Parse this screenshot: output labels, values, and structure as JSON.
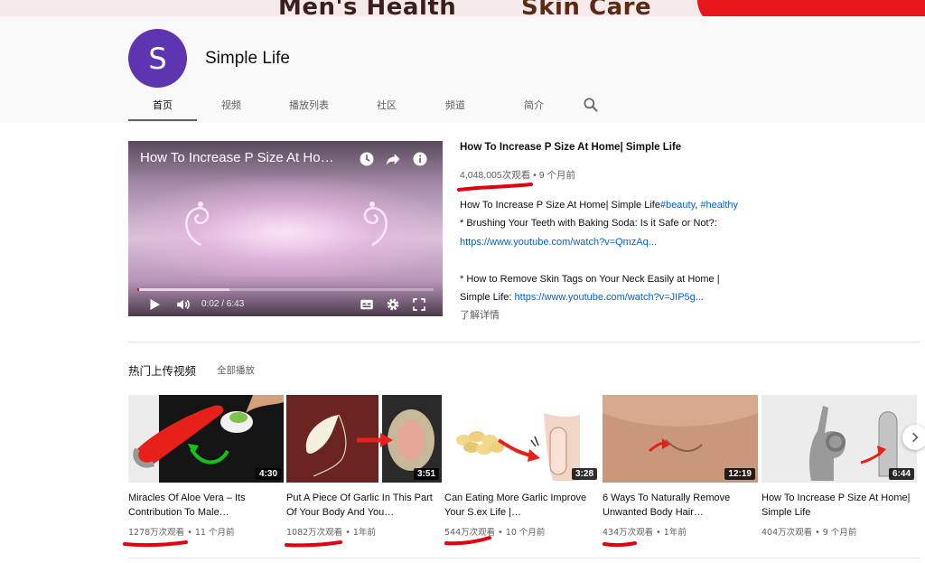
{
  "banner": {
    "text_left": "Men's Health",
    "text_right": "Skin Care"
  },
  "channel": {
    "avatar_letter": "S",
    "name": "Simple Life",
    "avatar_color": "#5e35b1"
  },
  "tabs": [
    {
      "label": "首页",
      "active": true
    },
    {
      "label": "视频"
    },
    {
      "label": "播放列表"
    },
    {
      "label": "社区"
    },
    {
      "label": "频道"
    },
    {
      "label": "简介"
    }
  ],
  "featured": {
    "overlay_title": "How To Increase P Size At Home| Simple Life",
    "time": "0:02 / 6:43",
    "progress": 0.005,
    "title": "How To Increase P Size At Home| Simple Life",
    "views": "4,048,005次观看",
    "age": "9 个月前",
    "desc_line1_text": "How To Increase P Size At Home| Simple Life",
    "desc_tag1": "#beauty",
    "desc_sep": ", ",
    "desc_tag2": "#healthy",
    "desc_line2": "* Brushing Your Teeth with Baking Soda: Is it Safe or Not?:",
    "desc_link1": "https://www.youtube.com/watch?v=QmzAq...",
    "desc_line4": "* How to Remove Skin Tags on Your Neck Easily at Home |",
    "desc_line5_text": "Simple Life: ",
    "desc_link2": "https://www.youtube.com/watch?v=JIP5g...",
    "more": "了解详情"
  },
  "section": {
    "title": "热门上传视频",
    "play_all": "全部播放"
  },
  "videos": [
    {
      "title": "Miracles Of Aloe Vera – Its Contribution To Male…",
      "views": "1278万次观看",
      "age": "11 个月前",
      "duration": "4:30"
    },
    {
      "title": "Put A Piece Of Garlic In This Part Of Your Body And You…",
      "views": "1082万次观看",
      "age": "1年前",
      "duration": "3:51"
    },
    {
      "title": "Can Eating More Garlic Improve Your S.ex Life |…",
      "views": "544万次观看",
      "age": "10 个月前",
      "duration": "3:28"
    },
    {
      "title": "6 Ways To Naturally Remove Unwanted Body Hair…",
      "views": "434万次观看",
      "age": "1年前",
      "duration": "12:19"
    },
    {
      "title": "How To Increase P Size At Home| Simple Life",
      "views": "404万次观看",
      "age": "9 个月前",
      "duration": "6:44"
    }
  ],
  "meta_sep": " • ",
  "colors": {
    "link": "#065fd4",
    "annotation": "#e5000f",
    "progress": "#ff0000"
  },
  "icons": [
    "search-icon",
    "watch-later-icon",
    "share-icon",
    "info-icon",
    "play-icon",
    "volume-icon",
    "subtitles-icon",
    "settings-icon",
    "fullscreen-icon",
    "chevron-right-icon"
  ]
}
